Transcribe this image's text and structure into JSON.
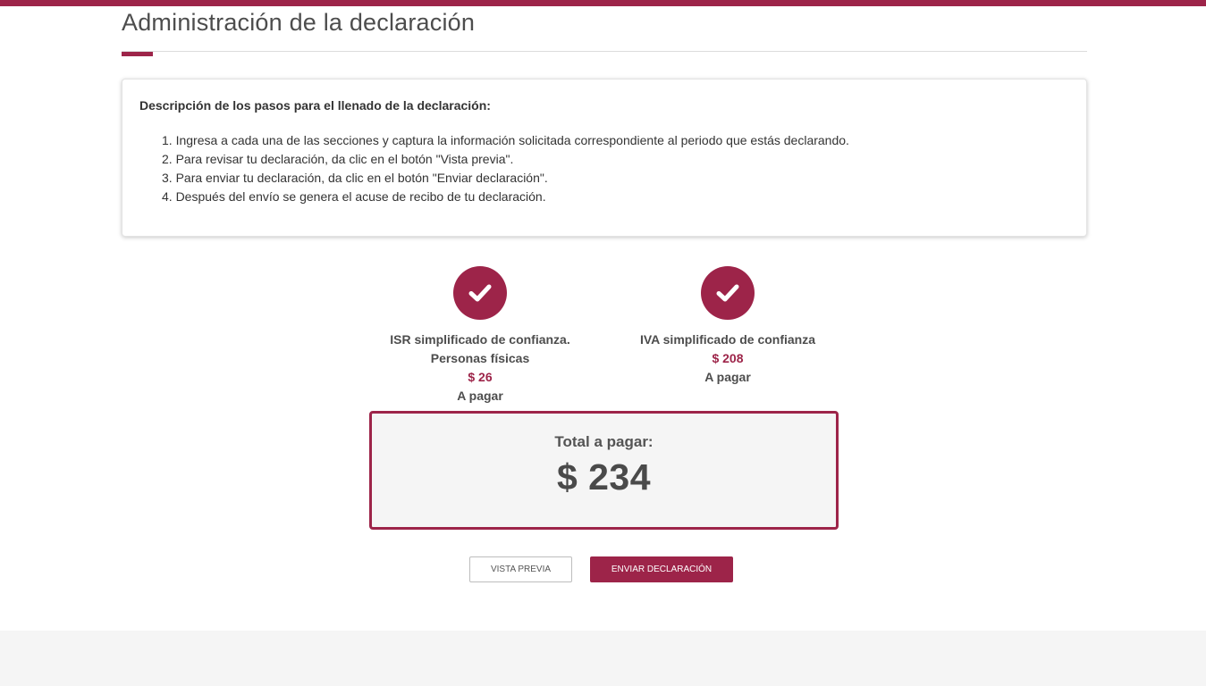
{
  "page": {
    "title": "Administración de la declaración"
  },
  "steps": {
    "heading": "Descripción de los pasos para el llenado de la declaración:",
    "items": [
      "1. Ingresa a cada una de las secciones y captura la información solicitada correspondiente al periodo que estás declarando.",
      "2. Para revisar tu declaración, da clic en el botón \"Vista previa\".",
      "3. Para enviar tu declaración, da clic en el botón \"Enviar declaración\".",
      "4. Después del envío se genera el acuse de recibo de tu declaración."
    ]
  },
  "taxes": [
    {
      "icon": "check-icon",
      "line1": "ISR simplificado de confianza.",
      "line2": "Personas físicas",
      "amount": "$ 26",
      "status": "A pagar"
    },
    {
      "icon": "check-icon",
      "line1": "IVA simplificado de confianza",
      "amount": "$ 208",
      "status": "A pagar"
    }
  ],
  "total": {
    "label": "Total a pagar:",
    "amount": "$ 234"
  },
  "buttons": {
    "preview_label": "VISTA PREVIA",
    "send_label": "ENVIAR DECLARACIÓN"
  },
  "colors": {
    "accent": "#9d2449",
    "text": "#4d4d4d",
    "footer": "#f5f5f5"
  }
}
